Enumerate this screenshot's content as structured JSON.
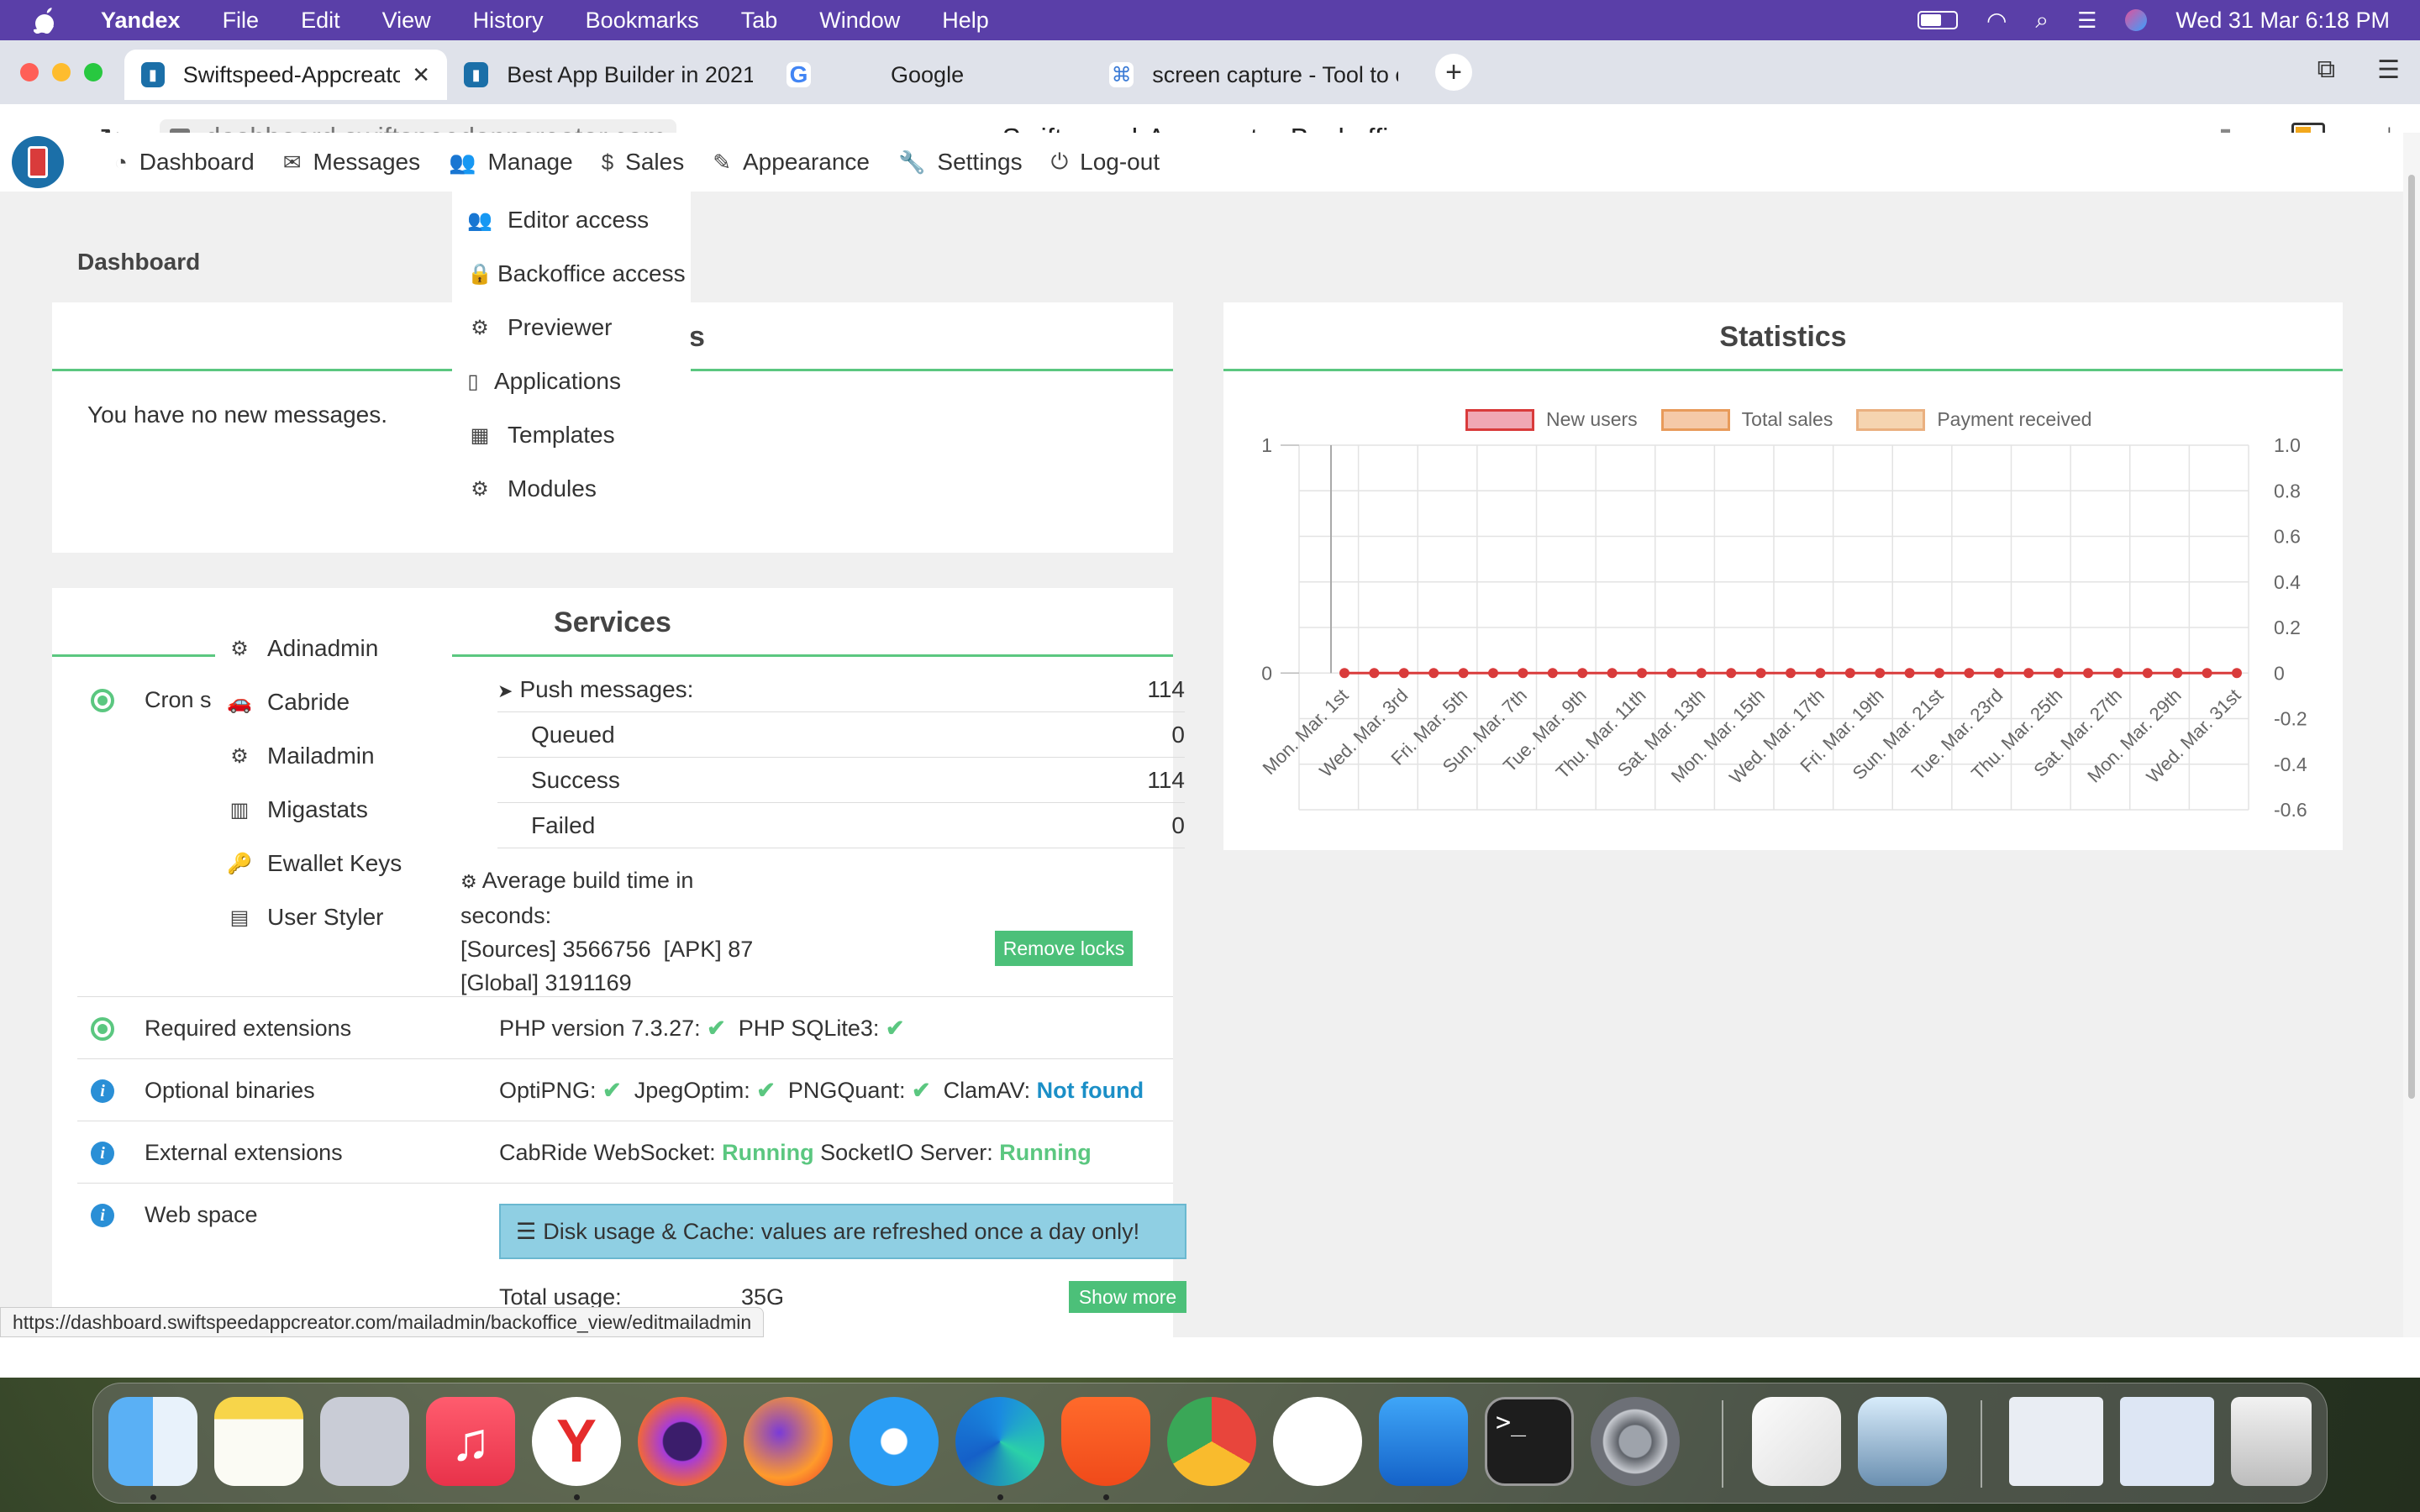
{
  "menubar": {
    "app": "Yandex",
    "items": [
      "File",
      "Edit",
      "View",
      "History",
      "Bookmarks",
      "Tab",
      "Window",
      "Help"
    ],
    "datetime": "Wed 31 Mar  6:18 PM"
  },
  "tabs": [
    {
      "title": "Swiftspeed-Appcreato",
      "active": true
    },
    {
      "title": "Best App Builder in 2021"
    },
    {
      "title": "Google"
    },
    {
      "title": "screen capture - Tool to c"
    }
  ],
  "address": {
    "url": "dashboard.swiftspeedappcreator.com",
    "page_title": "Swiftspeed-Appcreator Backoffice"
  },
  "nav": {
    "items": [
      {
        "label": "Dashboard",
        "icon": "dashboard-icon"
      },
      {
        "label": "Messages",
        "icon": "envelope-icon"
      },
      {
        "label": "Manage",
        "icon": "users-icon"
      },
      {
        "label": "Sales",
        "icon": "dollar-icon"
      },
      {
        "label": "Appearance",
        "icon": "pencil-icon"
      },
      {
        "label": "Settings",
        "icon": "wrench-icon"
      },
      {
        "label": "Log-out",
        "icon": "power-icon"
      }
    ]
  },
  "breadcrumb": "Dashboard",
  "manage_menu": {
    "items": [
      {
        "label": "Editor access",
        "icon": "users-icon"
      },
      {
        "label": "Backoffice access",
        "icon": "lock-icon"
      },
      {
        "label": "Previewer",
        "icon": "gear-icon"
      },
      {
        "label": "Applications",
        "icon": "mobile-icon"
      },
      {
        "label": "Templates",
        "icon": "grid-icon"
      },
      {
        "label": "Modules",
        "icon": "gear-icon"
      }
    ]
  },
  "modules_menu": {
    "items": [
      {
        "label": "Adinadmin",
        "icon": "gears-icon"
      },
      {
        "label": "Cabride",
        "icon": "car-icon"
      },
      {
        "label": "Mailadmin",
        "icon": "gears-icon"
      },
      {
        "label": "Migastats",
        "icon": "bar-chart-icon"
      },
      {
        "label": "Ewallet Keys",
        "icon": "key-icon"
      },
      {
        "label": "User Styler",
        "icon": "document-icon"
      }
    ]
  },
  "messages_panel": {
    "title_fragment": "s",
    "text": "You have no new messages."
  },
  "services": {
    "title": "Services",
    "cron_label": "Cron s",
    "push_label": "Push messages:",
    "push_value": "114",
    "queued_label": "Queued",
    "queued_value": "0",
    "success_label": "Success",
    "success_value": "114",
    "failed_label": "Failed",
    "failed_value": "0",
    "build_line1": "Average build time in",
    "build_line2": "seconds:",
    "build_line3": "[Sources] 3566756  [APK] 87",
    "build_line4": "[Global] 3191169",
    "remove_locks": "Remove locks",
    "required_label": "Required extensions",
    "php_version": "PHP version 7.3.27:",
    "php_sqlite": "PHP SQLite3:",
    "optional_label": "Optional binaries",
    "optipng": "OptiPNG:",
    "jpegoptim": "JpegOptim:",
    "pngquant": "PNGQuant:",
    "clamav": "ClamAV:",
    "clamav_status": "Not found",
    "external_label": "External extensions",
    "cabride_ws": "CabRide WebSocket:",
    "cabride_status": "Running",
    "socketio": "SocketIO Server:",
    "socketio_status": "Running",
    "webspace_label": "Web space",
    "disk_notice": "Disk usage & Cache: values are refreshed once a day only!",
    "total_usage_label": "Total usage:",
    "total_usage_value": "35G",
    "show_more": "Show more"
  },
  "statistics": {
    "title": "Statistics"
  },
  "chart_data": {
    "type": "line",
    "legend": [
      "New users",
      "Total sales",
      "Payment received"
    ],
    "legend_colors": [
      "#f0a8b4",
      "#f5c9a8",
      "#f5d4b0"
    ],
    "legend_borders": [
      "#d93b3b",
      "#e89a5a",
      "#eab080"
    ],
    "categories": [
      "Mon. Mar. 1st",
      "Wed. Mar. 3rd",
      "Fri. Mar. 5th",
      "Sun. Mar. 7th",
      "Tue. Mar. 9th",
      "Thu. Mar. 11th",
      "Sat. Mar. 13th",
      "Mon. Mar. 15th",
      "Wed. Mar. 17th",
      "Fri. Mar. 19th",
      "Sun. Mar. 21st",
      "Tue. Mar. 23rd",
      "Thu. Mar. 25th",
      "Sat. Mar. 27th",
      "Mon. Mar. 29th",
      "Wed. Mar. 31st"
    ],
    "point_count": 31,
    "series": [
      {
        "name": "New users",
        "value_each_day": 0
      }
    ],
    "left_axis": {
      "ticks": [
        "1",
        "0"
      ],
      "ylim": [
        0,
        1
      ]
    },
    "right_axis": {
      "ticks": [
        "1.0",
        "0.8",
        "0.6",
        "0.4",
        "0.2",
        "0",
        "-0.2",
        "-0.4",
        "-0.6"
      ],
      "ylim": [
        -0.6,
        1.0
      ]
    },
    "grid": true,
    "legend_position": "top"
  },
  "status_url": "https://dashboard.swiftspeedappcreator.com/mailadmin/backoffice_view/editmailadmin"
}
